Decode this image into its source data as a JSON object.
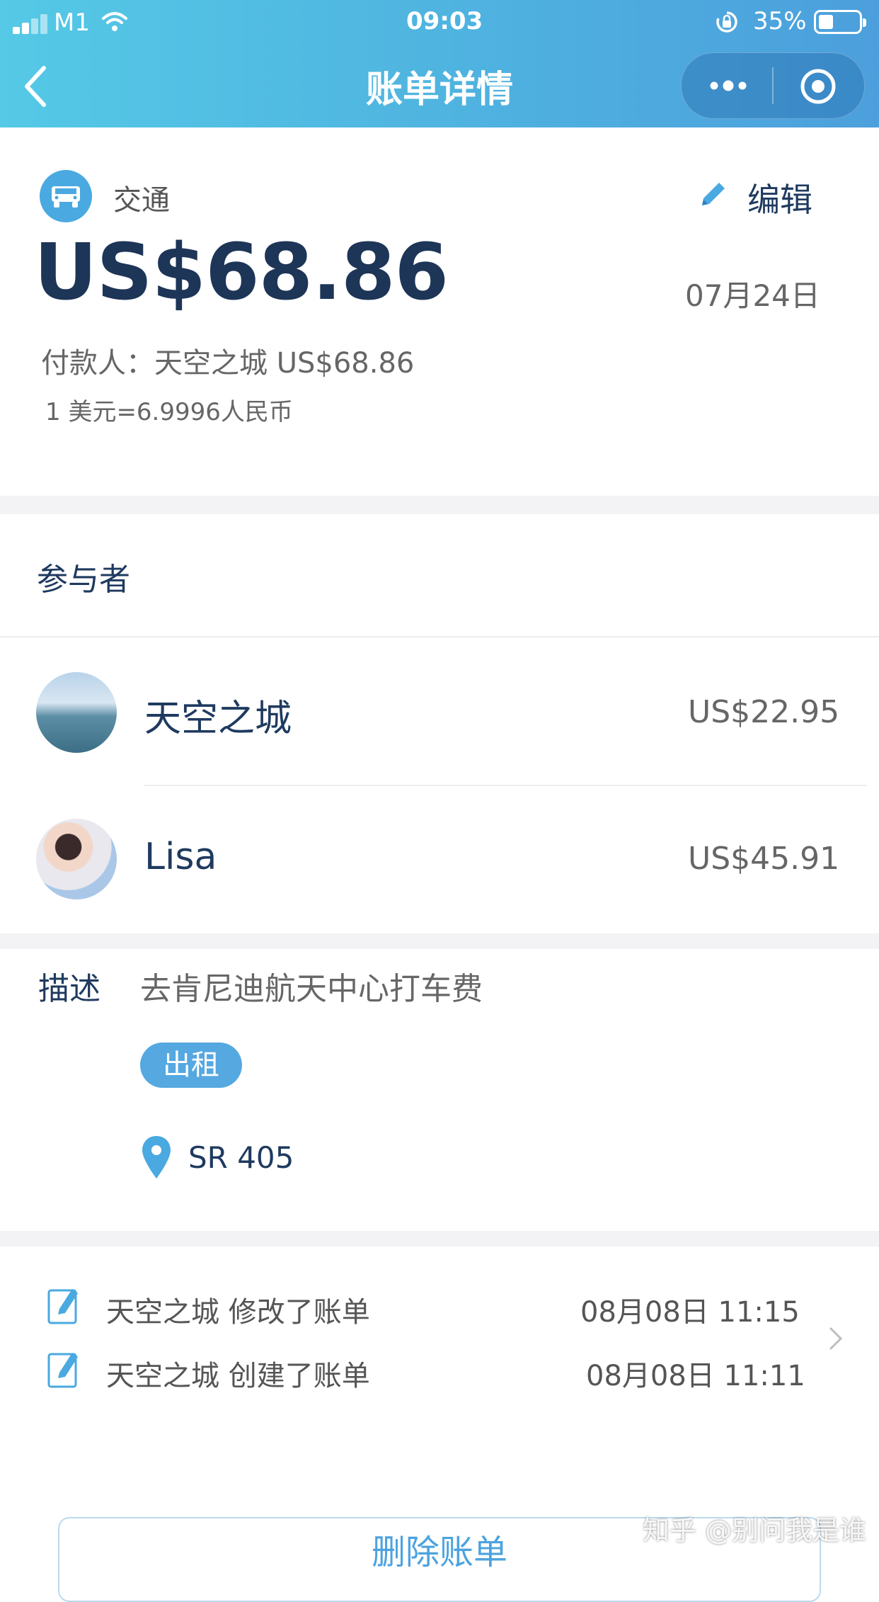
{
  "status_bar": {
    "carrier": "M1",
    "time": "09:03",
    "battery": "35%",
    "battery_level": 0.35
  },
  "nav": {
    "title": "账单详情",
    "back_icon": "chevron-left-icon",
    "more_icon": "more-dots-icon",
    "close_icon": "target-circle-icon"
  },
  "summary": {
    "category": "交通",
    "category_icon": "car-icon",
    "edit_label": "编辑",
    "amount": "US$68.86",
    "date": "07月24日",
    "payer": "付款人：天空之城 US$68.86",
    "exchange_rate": "1 美元=6.9996人民币"
  },
  "participants": {
    "title": "参与者",
    "items": [
      {
        "name": "天空之城",
        "amount": "US$22.95"
      },
      {
        "name": "Lisa",
        "amount": "US$45.91"
      }
    ]
  },
  "description": {
    "label": "描述",
    "text": "去肯尼迪航天中心打车费",
    "tag": "出租",
    "location": "SR 405"
  },
  "activity_log": [
    {
      "text": "天空之城 修改了账单",
      "date": "08月08日 11:15"
    },
    {
      "text": "天空之城 创建了账单",
      "date": "08月08日 11:11"
    }
  ],
  "delete_button": "删除账单",
  "watermark": "知乎 @别问我是谁",
  "colors": {
    "header_start": "#55c9e6",
    "header_end": "#4c9fdc",
    "accent": "#4da3df",
    "text_dark": "#1f3a5f"
  }
}
